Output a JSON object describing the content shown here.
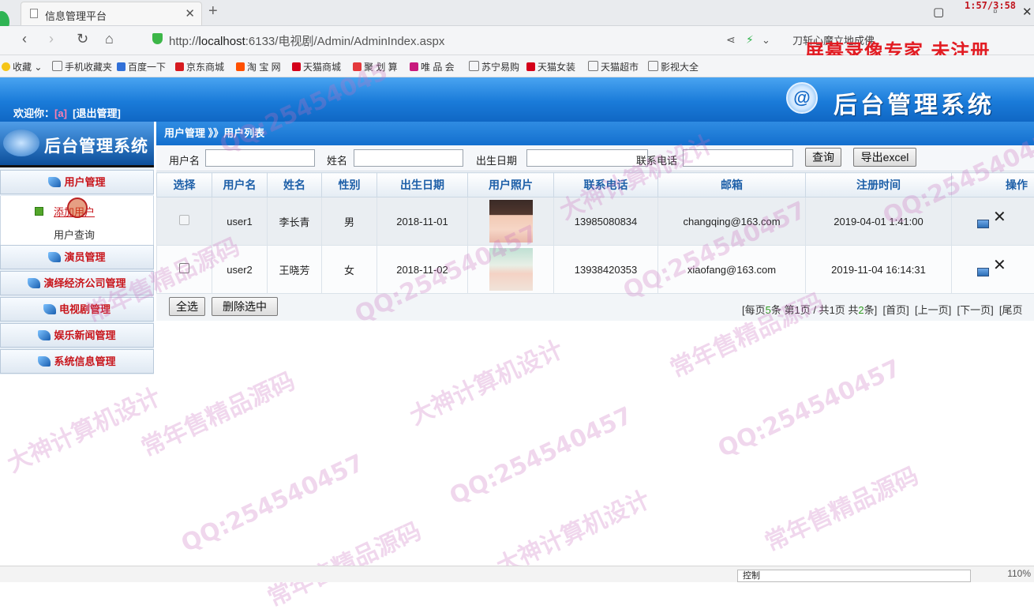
{
  "browser": {
    "tab_title": "信息管理平台",
    "tab_close": "✕",
    "new_tab": "+",
    "url_prefix": "http://",
    "url_host": "localhost",
    "url_rest": ":6133/电视剧/Admin/AdminIndex.aspx",
    "addr_right": "刀斩心魔立地成佛",
    "recorder_time": "1:57/3:58",
    "recorder_brand": "屏幕录像专家 未注册",
    "zoom": "110%",
    "status_control": "控制",
    "bookmarks": [
      "收藏",
      "手机收藏夹",
      "百度一下",
      "京东商城",
      "淘 宝 网",
      "天猫商城",
      "聚 划 算",
      "唯 品 会",
      "苏宁易购",
      "天猫女装",
      "天猫超市",
      "影视大全"
    ]
  },
  "header": {
    "welcome": "欢迎你：",
    "username": "[a]",
    "logout": "[退出管理]",
    "logo_text": "后台管理系统"
  },
  "sidebar": {
    "title": "后台管理系统",
    "menus": [
      "用户管理",
      "演员管理",
      "演绎经济公司管理",
      "电视剧管理",
      "娱乐新闻管理",
      "系统信息管理"
    ],
    "sub_add": "添加用户",
    "sub_query": "用户查询"
  },
  "main": {
    "breadcrumb": "用户管理 》》用户列表",
    "search": {
      "username_label": "用户名",
      "name_label": "姓名",
      "birth_label": "出生日期",
      "phone_label": "联系电话",
      "query_button": "查询",
      "export_button": "导出excel"
    },
    "table": {
      "headers": [
        "选择",
        "用户名",
        "姓名",
        "性别",
        "出生日期",
        "用户照片",
        "联系电话",
        "邮箱",
        "注册时间",
        "操作"
      ],
      "rows": [
        {
          "username": "user1",
          "name": "李长青",
          "gender": "男",
          "birth": "2018-11-01",
          "phone": "13985080834",
          "email": "changqing@163.com",
          "registered": "2019-04-01 1:41:00"
        },
        {
          "username": "user2",
          "name": "王晓芳",
          "gender": "女",
          "birth": "2018-11-02",
          "phone": "13938420353",
          "email": "xiaofang@163.com",
          "registered": "2019-11-04 16:14:31"
        }
      ]
    },
    "select_all": "全选",
    "delete_selected": "删除选中",
    "pager": {
      "p1": "[每页",
      "per_page": "5",
      "p2": "条 第",
      "current": "1",
      "p3": "页 / 共",
      "total_pages": "1",
      "p4": "页 共",
      "total": "2",
      "p5": "条]",
      "first": "[首页]",
      "prev": "[上一页]",
      "next": "[下一页]",
      "last": "[尾页"
    }
  },
  "watermark": {
    "qq": "QQ:25454045",
    "qq_full": "QQ:254540457",
    "sell": "常年售精品源码",
    "design": "大神计算机设计"
  }
}
